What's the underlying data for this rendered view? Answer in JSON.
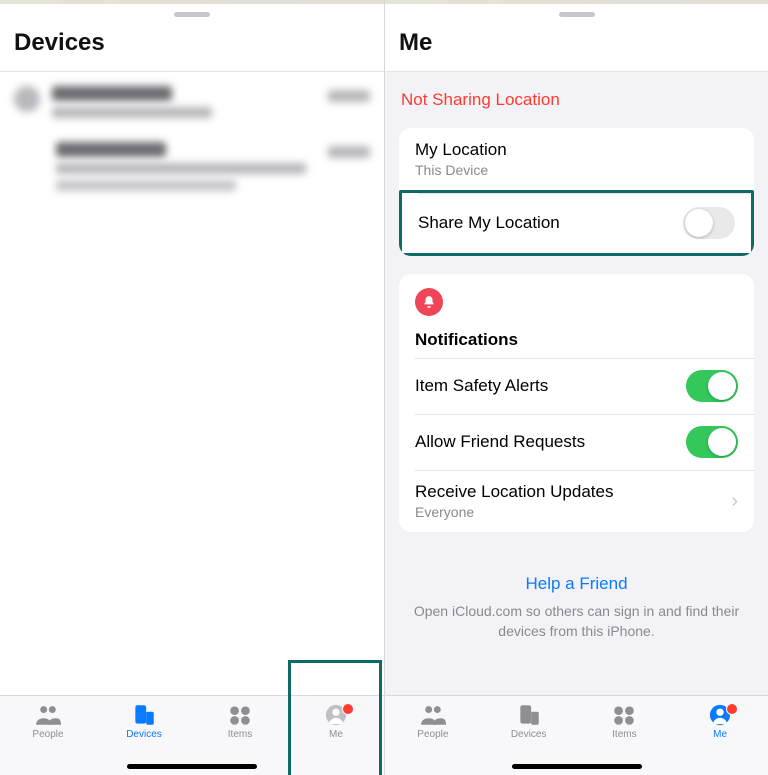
{
  "left": {
    "title": "Devices",
    "tabs": {
      "people": "People",
      "devices": "Devices",
      "items": "Items",
      "me": "Me"
    },
    "active_tab": "devices",
    "highlight_tab": "me"
  },
  "right": {
    "title": "Me",
    "status": "Not Sharing Location",
    "location_card": {
      "my_location_title": "My Location",
      "my_location_sub": "This Device",
      "share_title": "Share My Location",
      "share_on": false
    },
    "notifications": {
      "heading": "Notifications",
      "item_safety": "Item Safety Alerts",
      "item_safety_on": true,
      "friend_requests": "Allow Friend Requests",
      "friend_requests_on": true,
      "receive_title": "Receive Location Updates",
      "receive_sub": "Everyone"
    },
    "help": {
      "link": "Help a Friend",
      "sub": "Open iCloud.com so others can sign in and find their devices from this iPhone."
    },
    "tabs": {
      "people": "People",
      "devices": "Devices",
      "items": "Items",
      "me": "Me"
    },
    "active_tab": "me"
  }
}
